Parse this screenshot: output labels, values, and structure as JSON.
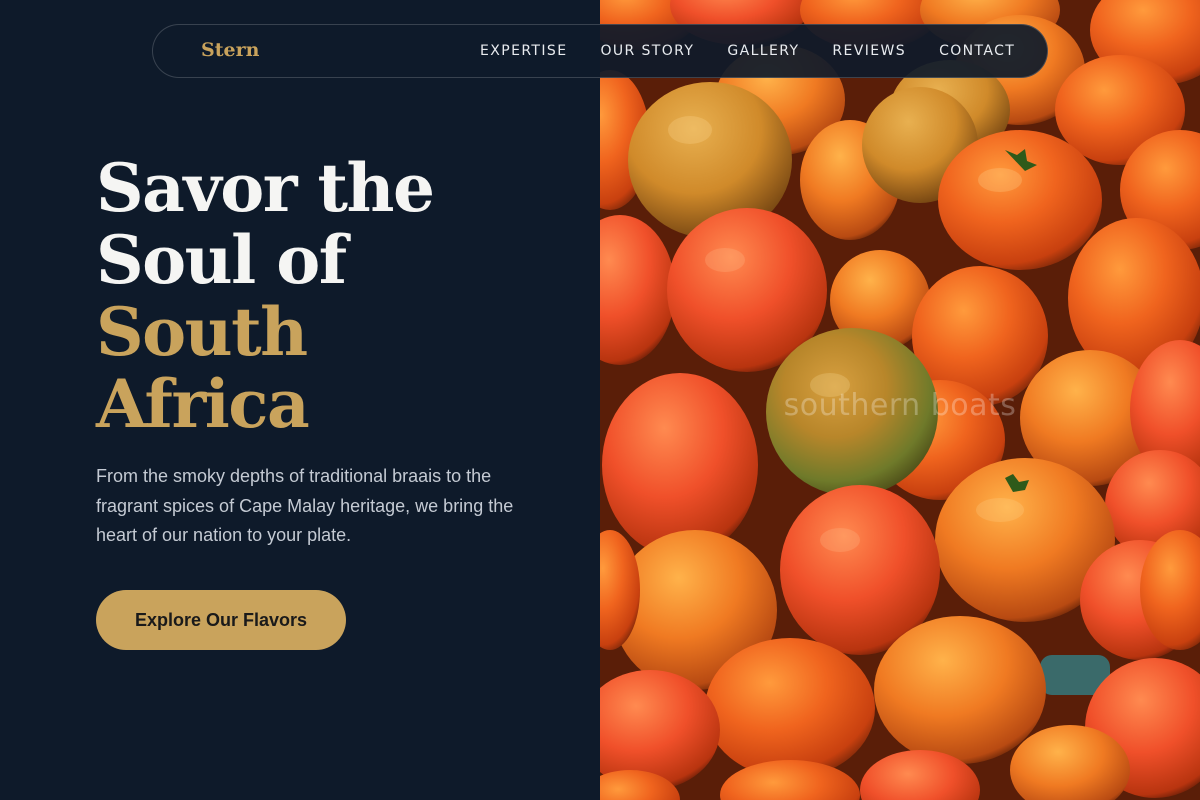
{
  "brand": {
    "name": "Stern"
  },
  "nav": {
    "items": [
      {
        "label": "EXPERTISE"
      },
      {
        "label": "OUR STORY"
      },
      {
        "label": "GALLERY"
      },
      {
        "label": "REVIEWS"
      },
      {
        "label": "CONTACT"
      }
    ]
  },
  "hero": {
    "headline_line1": "Savor the",
    "headline_line2": "Soul of",
    "headline_line3": "South",
    "headline_line4": "Africa",
    "subtext": "From the smoky depths of traditional braais to the fragrant spices of Cape Malay heritage, we bring the heart of our nation to your plate.",
    "cta_label": "Explore Our Flavors"
  },
  "photo": {
    "watermark": "southern boats"
  },
  "colors": {
    "background": "#0e1a2a",
    "accent_gold": "#c9a35c",
    "headline_white": "#f5f5f3",
    "body_text": "#c4cad3"
  }
}
